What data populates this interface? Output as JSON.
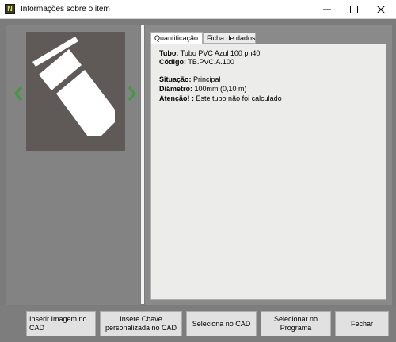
{
  "window": {
    "title": "Informações sobre o item",
    "icon_letter": "N"
  },
  "tabs": [
    {
      "label": "Quantificação",
      "active": true
    },
    {
      "label": "Ficha de dados",
      "active": false
    }
  ],
  "details": {
    "tubo_label": "Tubo:",
    "tubo_value": "Tubo PVC Azul 100 pn40",
    "codigo_label": "Código:",
    "codigo_value": "TB.PVC.A.100",
    "situacao_label": "Situação:",
    "situacao_value": "Principal",
    "diametro_label": "Diâmetro:",
    "diametro_value": "100mm (0,10 m)",
    "atencao_label": "Atenção! :",
    "atencao_value": "Este tubo não foi calculado"
  },
  "buttons": {
    "insert_image": "Inserir Imagem no CAD",
    "insert_key": "Insere Chave personalizada no CAD",
    "select_cad": "Seleciona no CAD",
    "select_program": "Selecionar no Programa",
    "close": "Fechar"
  },
  "colors": {
    "nav_arrow": "#3e9a3a",
    "preview_bg": "#5f5a58"
  },
  "icons": {
    "app": "app-logo-icon",
    "minimize": "minimize-icon",
    "maximize": "maximize-icon",
    "close": "close-icon",
    "prev": "chevron-left-icon",
    "next": "chevron-right-icon",
    "pipe": "pipe-icon"
  }
}
